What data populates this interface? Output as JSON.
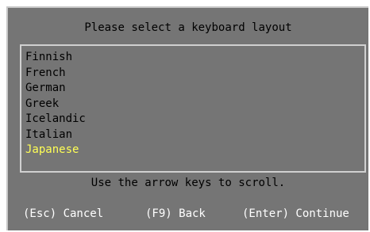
{
  "dialog": {
    "title": "Please select a keyboard layout",
    "items": [
      {
        "label": "Finnish",
        "selected": false
      },
      {
        "label": "French",
        "selected": false
      },
      {
        "label": "German",
        "selected": false
      },
      {
        "label": "Greek",
        "selected": false
      },
      {
        "label": "Icelandic",
        "selected": false
      },
      {
        "label": "Italian",
        "selected": false
      },
      {
        "label": "Japanese",
        "selected": true
      }
    ],
    "hint": "Use the arrow keys to scroll.",
    "buttons": {
      "cancel": "(Esc) Cancel",
      "back": "(F9) Back",
      "continue": "(Enter) Continue"
    }
  },
  "colors": {
    "dialog_background": "#757575",
    "text": "#000000",
    "selected_text": "#ffff55",
    "button_text": "#ffffff",
    "border": "#d0d0d0"
  }
}
